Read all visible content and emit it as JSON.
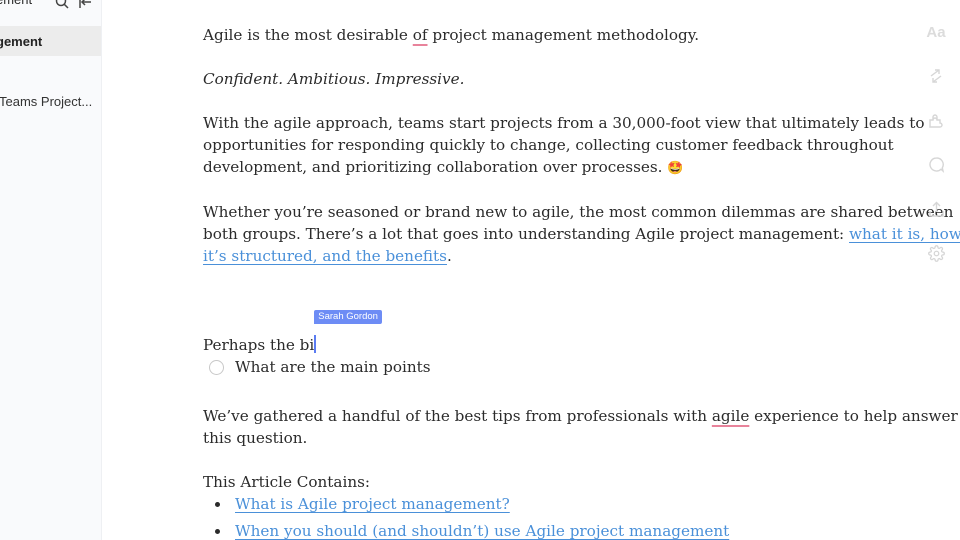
{
  "sidebar": {
    "title": "ement",
    "items": [
      {
        "label": "gement",
        "active": true
      },
      {
        "label": "Teams Project...",
        "active": false
      }
    ]
  },
  "document": {
    "p1": {
      "before": "Agile is the most desirable ",
      "flagged": "of",
      "after": " project management methodology."
    },
    "p2": "Confident. Ambitious. Impressive.",
    "p3": {
      "lines": [
        "With the agile approach, teams start projects from a 30,000-foot view that ultimately leads to",
        "opportunities for responding quickly to change, collecting customer feedback throughout",
        "development, and prioritizing collaboration over processes."
      ],
      "emoji": "🤩"
    },
    "p4": {
      "line1": "Whether you’re seasoned or brand new to agile, the most common dilemmas are shared between",
      "line2_text": "both groups. There’s a lot that goes into understanding Agile project management: ",
      "line2_link": "what it is, how ",
      "line3_link": "it’s structured, and the benefits",
      "line3_after": "."
    },
    "p5": {
      "text": "Perhaps the bi",
      "collaborator": "Sarah Gordon",
      "collaborator_color": "#6d8cf5"
    },
    "todo": {
      "label": "What are the main points",
      "checked": false
    },
    "p6": {
      "line1_before": "We’ve gathered a handful of the best tips from professionals with ",
      "line1_flagged": "agile",
      "line1_after": " experience to help answer",
      "line2": "this question."
    },
    "toc": {
      "heading": "This Article Contains:",
      "items": [
        "What is Agile project management? ",
        "When you should (and shouldn’t) use Agile project management"
      ]
    }
  },
  "right_toolbar": {
    "items": [
      {
        "icon": "text-format-icon",
        "label": "Aa"
      },
      {
        "icon": "sync-arrows-icon"
      },
      {
        "icon": "puzzle-icon"
      },
      {
        "icon": "comment-icon"
      },
      {
        "icon": "share-upload-icon"
      },
      {
        "icon": "gear-icon"
      }
    ]
  },
  "colors": {
    "link": "#4a90d9",
    "spellcheck": "#e8839b",
    "collaborator": "#6d8cf5"
  }
}
